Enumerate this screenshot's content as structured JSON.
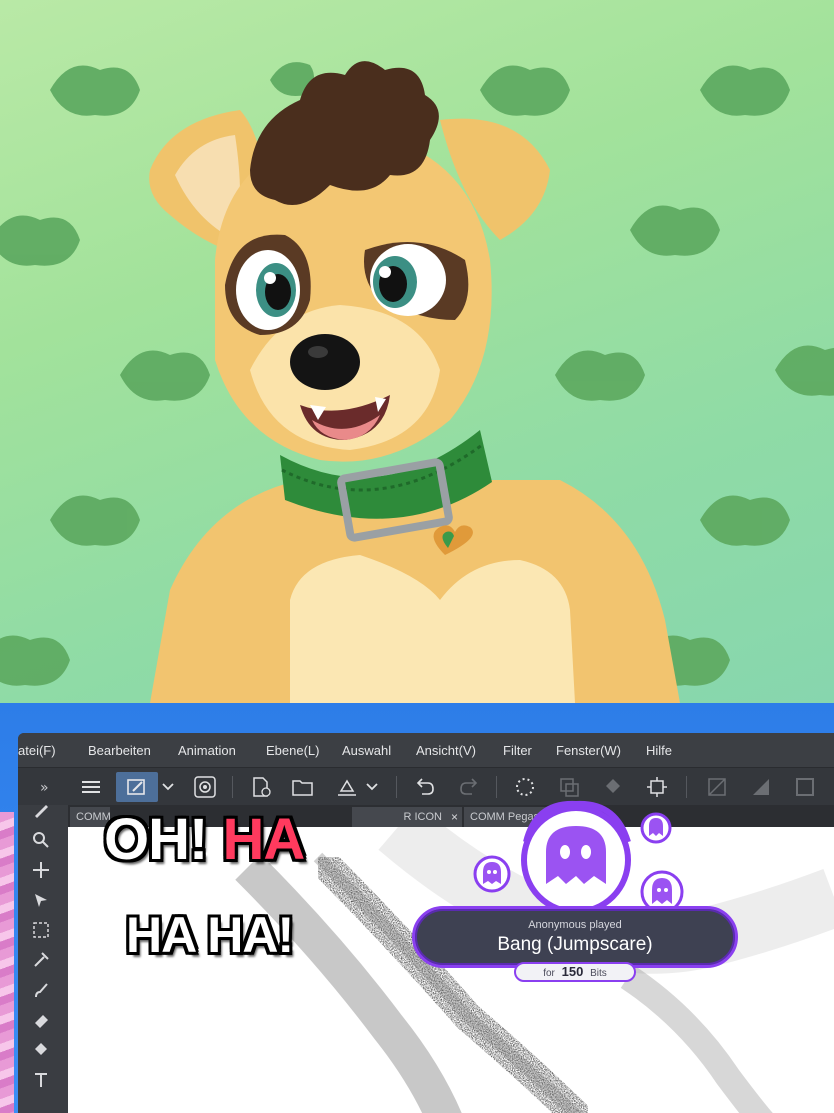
{
  "stream": {
    "caption_line1_a": "OH!",
    "caption_line1_b": "HA",
    "caption_line2": "HA HA!"
  },
  "app": {
    "menu": [
      "atei(F)",
      "Bearbeiten",
      "Animation",
      "Ebene(L)",
      "Auswahl",
      "Ansicht(V)",
      "Filter",
      "Fenster(W)",
      "Hilfe"
    ],
    "tabs": [
      {
        "label": "COMM",
        "close": ""
      },
      {
        "label": "R ICON",
        "close": "×"
      },
      {
        "label": "COMM Pegasys",
        "close": "×"
      }
    ]
  },
  "alert": {
    "user_line": "Anonymous played",
    "title": "Bang (Jumpscare)",
    "for_label": "for",
    "amount": "150",
    "unit": "Bits"
  },
  "colors": {
    "caption_highlight": "#ff3a5e",
    "alert_accent": "#8a3ff0",
    "frame_blue": "#2d7de8",
    "bg_green": "#a2e29b"
  }
}
